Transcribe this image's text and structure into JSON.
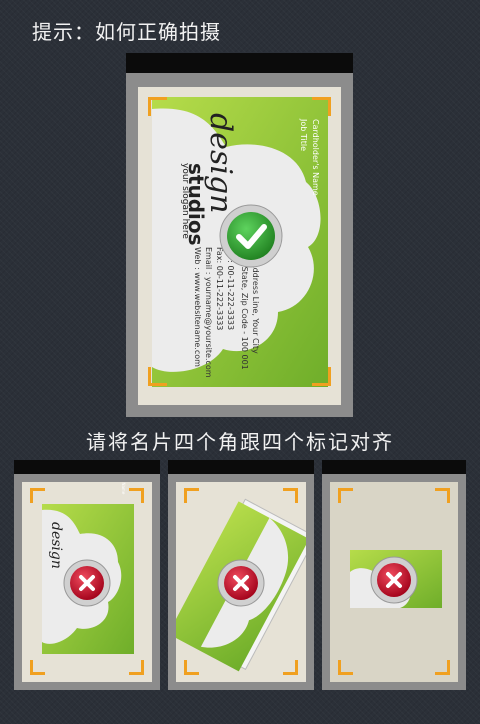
{
  "header": {
    "hint": "提示：如何正确拍摄"
  },
  "caption": "请将名片四个角跟四个标记对齐",
  "card": {
    "brand_script": "design",
    "brand_name": "studios",
    "slogan": "your slogan here",
    "holder": "Cardholder's Name",
    "job_title": "Job Title",
    "address1": "99, Address Line, Your City",
    "address2": "Your State, Zip Code - 100 001",
    "tel": "Tel : 00-11-222-3333",
    "fax": "Fax: 00-11-222-3333",
    "email": "Email : yourname@yoursite.com",
    "web": "Web : www.websitename.com"
  },
  "examples": [
    {
      "result": "correct",
      "icon": "check-icon"
    },
    {
      "result": "wrong",
      "icon": "cross-icon",
      "reason": "card too small"
    },
    {
      "result": "wrong",
      "icon": "cross-icon",
      "reason": "card tilted"
    },
    {
      "result": "wrong",
      "icon": "cross-icon",
      "reason": "card too far"
    }
  ],
  "colors": {
    "corner_marker": "#f0a020",
    "card_green": "#8cc63f",
    "check_green": "#2e9e2e",
    "cross_red": "#c8102e"
  }
}
